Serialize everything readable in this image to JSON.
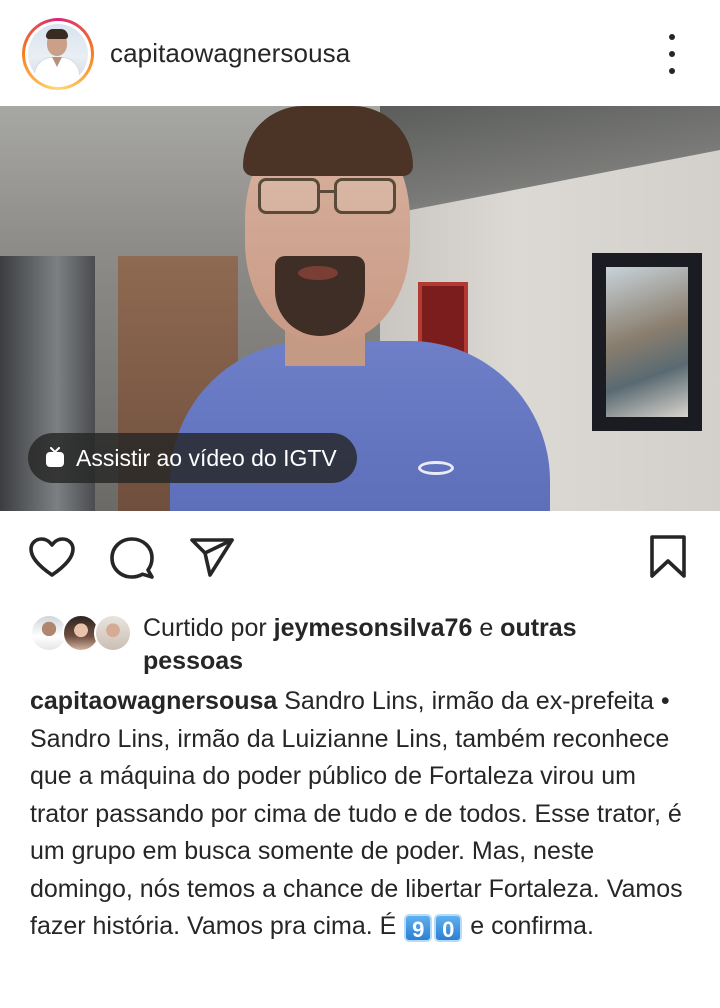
{
  "post": {
    "username": "capitaowagnersousa",
    "igtv_label": "Assistir ao vídeo do IGTV",
    "likes": {
      "prefix": "Curtido por ",
      "liker": "jeymesonsilva76",
      "connector": " e ",
      "others": "outras pessoas"
    },
    "caption": {
      "username": "capitaowagnersousa",
      "text": " Sandro Lins, irmão da ex-prefeita • Sandro Lins, irmão da Luizianne Lins, também reconhece que a máquina do poder público de Fortaleza virou um trator passando por cima de tudo e de todos. Esse trator, é um grupo em busca somente de poder. Mas, neste domingo, nós temos a chance de libertar Fortaleza. Vamos fazer história. Vamos pra cima. É ",
      "digit_1": "9",
      "digit_2": "0",
      "suffix": " e confirma."
    }
  },
  "icons": {
    "more": "more-vertical-icon",
    "like": "heart-icon",
    "comment": "comment-icon",
    "share": "paper-plane-icon",
    "save": "bookmark-icon",
    "igtv": "igtv-icon"
  },
  "colors": {
    "text": "#262626",
    "pill_bg": "#262626",
    "keycap": "#2c7fd6"
  }
}
